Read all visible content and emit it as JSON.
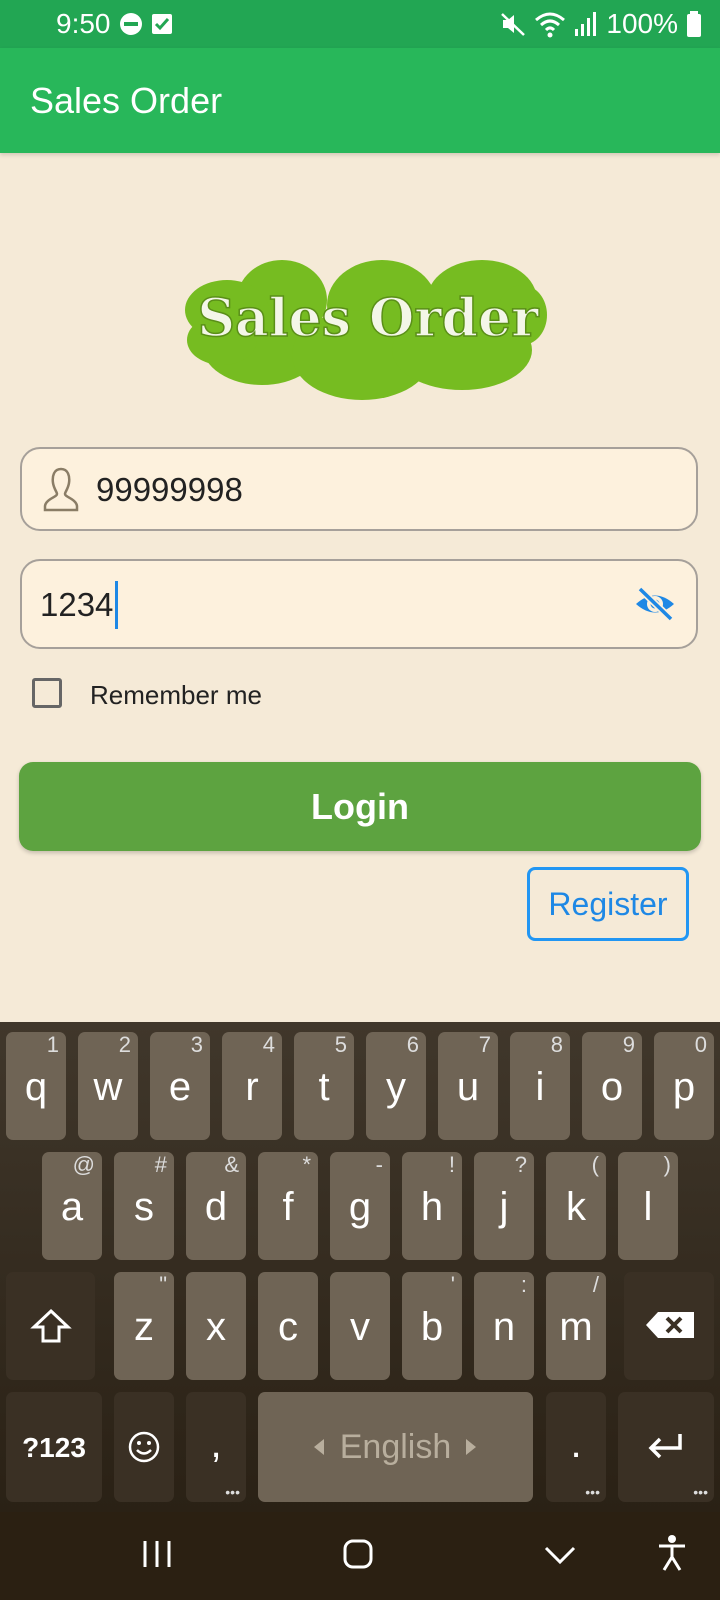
{
  "status_bar": {
    "time": "9:50",
    "battery": "100%"
  },
  "app_bar": {
    "title": "Sales Order"
  },
  "logo": {
    "text": "Sales Order",
    "color": "#76bc21"
  },
  "form": {
    "username_value": "99999998",
    "password_value": "1234",
    "remember_label": "Remember me",
    "remember_checked": false,
    "login_label": "Login",
    "register_label": "Register"
  },
  "keyboard": {
    "row1": [
      {
        "k": "q",
        "h": "1"
      },
      {
        "k": "w",
        "h": "2"
      },
      {
        "k": "e",
        "h": "3"
      },
      {
        "k": "r",
        "h": "4"
      },
      {
        "k": "t",
        "h": "5"
      },
      {
        "k": "y",
        "h": "6"
      },
      {
        "k": "u",
        "h": "7"
      },
      {
        "k": "i",
        "h": "8"
      },
      {
        "k": "o",
        "h": "9"
      },
      {
        "k": "p",
        "h": "0"
      }
    ],
    "row2": [
      {
        "k": "a",
        "h": "@"
      },
      {
        "k": "s",
        "h": "#"
      },
      {
        "k": "d",
        "h": "&"
      },
      {
        "k": "f",
        "h": "*"
      },
      {
        "k": "g",
        "h": "-"
      },
      {
        "k": "h",
        "h": "!"
      },
      {
        "k": "j",
        "h": "?"
      },
      {
        "k": "k",
        "h": "("
      },
      {
        "k": "l",
        "h": ")"
      }
    ],
    "row3": [
      {
        "k": "z",
        "h": "\""
      },
      {
        "k": "x",
        "h": ""
      },
      {
        "k": "c",
        "h": ""
      },
      {
        "k": "v",
        "h": ""
      },
      {
        "k": "b",
        "h": "'"
      },
      {
        "k": "n",
        "h": ":"
      },
      {
        "k": "m",
        "h": "/"
      }
    ],
    "symbols_label": "?123",
    "comma_label": ",",
    "space_label": "English",
    "period_label": ".",
    "shift_icon": "shift-icon",
    "backspace_icon": "backspace-icon",
    "emoji_icon": "emoji-icon",
    "enter_icon": "enter-icon"
  },
  "colors": {
    "status_bar": "#22a653",
    "app_bar": "#28b75a",
    "login": "#5da340",
    "register": "#1e88e5",
    "background": "#f5ead7"
  }
}
